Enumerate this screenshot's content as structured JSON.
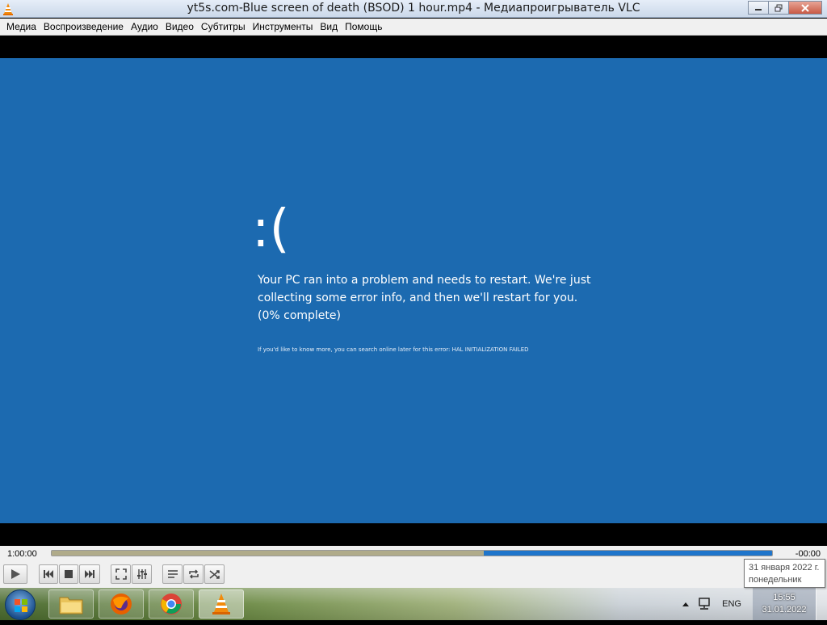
{
  "window": {
    "title": "yt5s.com-Blue screen of death (BSOD) 1 hour.mp4 - Медиапроигрыватель VLC",
    "icon": "vlc-cone-icon",
    "buttons": [
      "minimize",
      "maximize",
      "close"
    ]
  },
  "menu": {
    "items": [
      "Медиа",
      "Воспроизведение",
      "Аудио",
      "Видео",
      "Субтитры",
      "Инструменты",
      "Вид",
      "Помощь"
    ]
  },
  "video": {
    "background": "#1c6ab0",
    "face": ":(",
    "message": "Your PC ran into a problem and needs to restart. We're just collecting some error info, and then we'll restart for you. (0% complete)",
    "fine_print": "If you'd like to know more, you can search online later for this error: HAL INITIALIZATION FAILED"
  },
  "playback": {
    "elapsed": "1:00:00",
    "remaining": "-00:00",
    "played_fraction": 0.6,
    "buttons": [
      "play",
      "prev",
      "stop",
      "next",
      "fullscreen",
      "extended-settings",
      "playlist",
      "loop",
      "shuffle"
    ]
  },
  "tooltip": {
    "date": "31 января 2022 г.",
    "weekday": "понедельник"
  },
  "taskbar": {
    "apps": [
      "explorer",
      "firefox",
      "chrome",
      "vlc"
    ],
    "active_app": "vlc",
    "language": "ENG",
    "time": "15:55",
    "date": "31.01.2022"
  }
}
